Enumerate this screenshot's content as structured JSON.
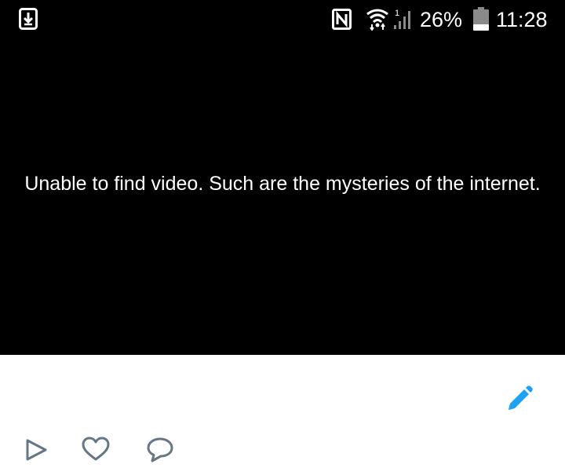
{
  "status_bar": {
    "battery_percent": "26%",
    "time": "11:28",
    "icons": [
      "download-icon",
      "nfc-icon",
      "wifi-icon",
      "signal-icon",
      "battery-icon"
    ],
    "signal_indicator_text": "1"
  },
  "video": {
    "error_message": "Unable to find video. Such are the mysteries of the internet."
  },
  "actions": {
    "icons": [
      "play-icon",
      "heart-icon",
      "comment-icon",
      "edit-icon"
    ]
  },
  "colors": {
    "video_background": "#000000",
    "content_background": "#ffffff",
    "accent": "#1da1f2",
    "action_icon": "#657786"
  }
}
